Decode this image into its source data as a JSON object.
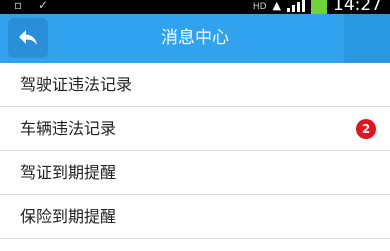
{
  "status_bar": {
    "time": "14:27",
    "network_type": "HD",
    "left_icons": "▫ ✓"
  },
  "title_bar": {
    "title": "消息中心"
  },
  "messages": [
    {
      "label": "驾驶证违法记录",
      "badge": ""
    },
    {
      "label": "车辆违法记录",
      "badge": "2"
    },
    {
      "label": "驾证到期提醒",
      "badge": ""
    },
    {
      "label": "保险到期提醒",
      "badge": ""
    }
  ],
  "colors": {
    "title_bar": "#31a3ee",
    "badge": "#e3141e"
  }
}
